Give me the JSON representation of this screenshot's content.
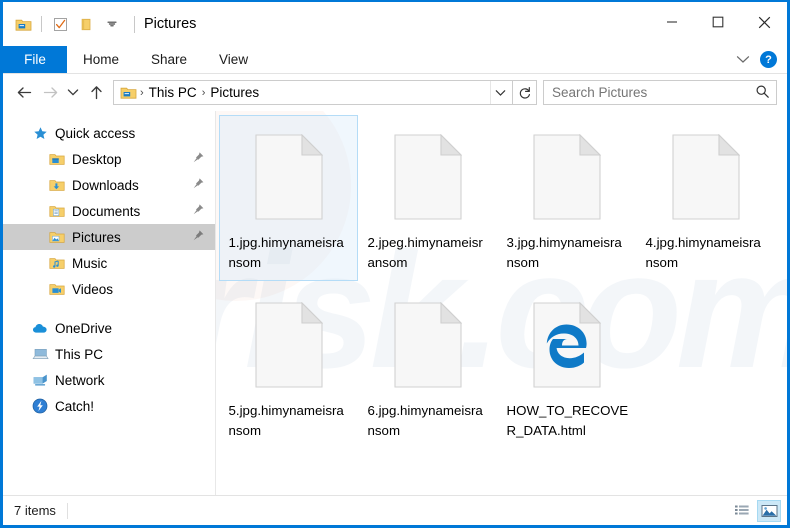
{
  "window": {
    "title": "Pictures",
    "quick_access_toolbar": [
      {
        "name": "properties-icon",
        "label": "Properties"
      },
      {
        "name": "checkbox-icon",
        "label": "Select"
      },
      {
        "name": "new-folder-icon",
        "label": "New folder"
      },
      {
        "name": "chevron-down-icon",
        "label": "Customize Quick Access Toolbar"
      }
    ],
    "controls": {
      "minimize": "–",
      "maximize": "☐",
      "close": "✕"
    }
  },
  "ribbon": {
    "tabs": [
      {
        "label": "File",
        "active": true
      },
      {
        "label": "Home",
        "active": false
      },
      {
        "label": "Share",
        "active": false
      },
      {
        "label": "View",
        "active": false
      }
    ],
    "expand_icon": "chevron-down-icon",
    "help_label": "?"
  },
  "address": {
    "back_icon": "←",
    "forward_icon": "→",
    "recent_icon": "∨",
    "up_icon": "↑",
    "breadcrumb": [
      "This PC",
      "Pictures"
    ],
    "separator": "›",
    "dropdown_icon": "∨",
    "refresh_icon": "↻"
  },
  "search": {
    "placeholder": "Search Pictures",
    "value": "",
    "icon": "search-icon"
  },
  "sidebar": {
    "items": [
      {
        "label": "Quick access",
        "icon": "star-icon",
        "level": 0,
        "pinned": false,
        "selected": false
      },
      {
        "label": "Desktop",
        "icon": "desktop-folder-icon",
        "level": 1,
        "pinned": true,
        "selected": false
      },
      {
        "label": "Downloads",
        "icon": "downloads-folder-icon",
        "level": 1,
        "pinned": true,
        "selected": false
      },
      {
        "label": "Documents",
        "icon": "documents-folder-icon",
        "level": 1,
        "pinned": true,
        "selected": false
      },
      {
        "label": "Pictures",
        "icon": "pictures-folder-icon",
        "level": 1,
        "pinned": true,
        "selected": true
      },
      {
        "label": "Music",
        "icon": "music-folder-icon",
        "level": 1,
        "pinned": false,
        "selected": false
      },
      {
        "label": "Videos",
        "icon": "videos-folder-icon",
        "level": 1,
        "pinned": false,
        "selected": false
      },
      {
        "label": "OneDrive",
        "icon": "onedrive-cloud-icon",
        "level": 0,
        "pinned": false,
        "selected": false
      },
      {
        "label": "This PC",
        "icon": "this-pc-icon",
        "level": 0,
        "pinned": false,
        "selected": false
      },
      {
        "label": "Network",
        "icon": "network-icon",
        "level": 0,
        "pinned": false,
        "selected": false
      },
      {
        "label": "Catch!",
        "icon": "catch-app-icon",
        "level": 0,
        "pinned": false,
        "selected": false
      }
    ],
    "pin_glyph": "📌"
  },
  "files": [
    {
      "name": "1.jpg.himynameisransom",
      "icon": "generic-file-icon",
      "selected": true
    },
    {
      "name": "2.jpeg.himynameisransom",
      "icon": "generic-file-icon",
      "selected": false
    },
    {
      "name": "3.jpg.himynameisransom",
      "icon": "generic-file-icon",
      "selected": false
    },
    {
      "name": "4.jpg.himynameisransom",
      "icon": "generic-file-icon",
      "selected": false
    },
    {
      "name": "5.jpg.himynameisransom",
      "icon": "generic-file-icon",
      "selected": false
    },
    {
      "name": "6.jpg.himynameisransom",
      "icon": "generic-file-icon",
      "selected": false
    },
    {
      "name": "HOW_TO_RECOVER_DATA.html",
      "icon": "edge-html-file-icon",
      "selected": false
    }
  ],
  "status": {
    "item_count": "7 items",
    "views": [
      {
        "name": "details-view-button",
        "active": false
      },
      {
        "name": "large-icons-view-button",
        "active": true
      }
    ]
  },
  "watermark": {
    "text": "risk.com"
  },
  "colors": {
    "accent": "#0078d7",
    "selection_fill": "#cde5f7",
    "selection_border": "#b4dcf7",
    "sidebar_selected": "#cccccc",
    "edge_blue": "#0f7ac7",
    "folder_yellow": "#ffd16a"
  }
}
